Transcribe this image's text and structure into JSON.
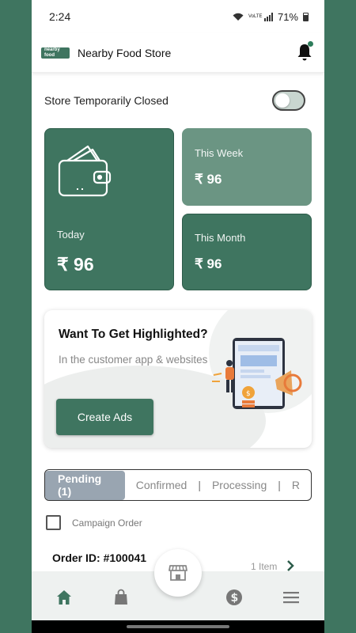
{
  "status_bar": {
    "time": "2:24",
    "network": "VoLTE",
    "battery": "71%"
  },
  "app_bar": {
    "logo_text": "nearby food",
    "title": "Nearby Food Store"
  },
  "store_status": {
    "label": "Store Temporarily Closed",
    "toggle_on": false
  },
  "earnings": {
    "currency": "₹",
    "today": {
      "label": "Today",
      "value": "₹ 96"
    },
    "week": {
      "label": "This Week",
      "value": "₹ 96"
    },
    "month": {
      "label": "This Month",
      "value": "₹ 96"
    }
  },
  "promo": {
    "title": "Want To Get Highlighted?",
    "subtitle": "In the customer app & websites",
    "button_label": "Create Ads"
  },
  "order_tabs": [
    {
      "label": "Pending (1)",
      "active": true
    },
    {
      "label": "Confirmed",
      "active": false
    },
    {
      "label": "Processing",
      "active": false
    },
    {
      "label": "R",
      "active": false
    }
  ],
  "campaign_filter": {
    "label": "Campaign Order",
    "checked": false
  },
  "order": {
    "id": "Order ID: #100041",
    "items": "1 Item"
  },
  "bottom_nav": [
    "home-icon",
    "shopping-bag-icon",
    "store-icon",
    "dollar-icon",
    "menu-icon"
  ],
  "colors": {
    "primary": "#3f7560",
    "light_primary": "#6b9583",
    "tab_active": "#99a5b1"
  }
}
